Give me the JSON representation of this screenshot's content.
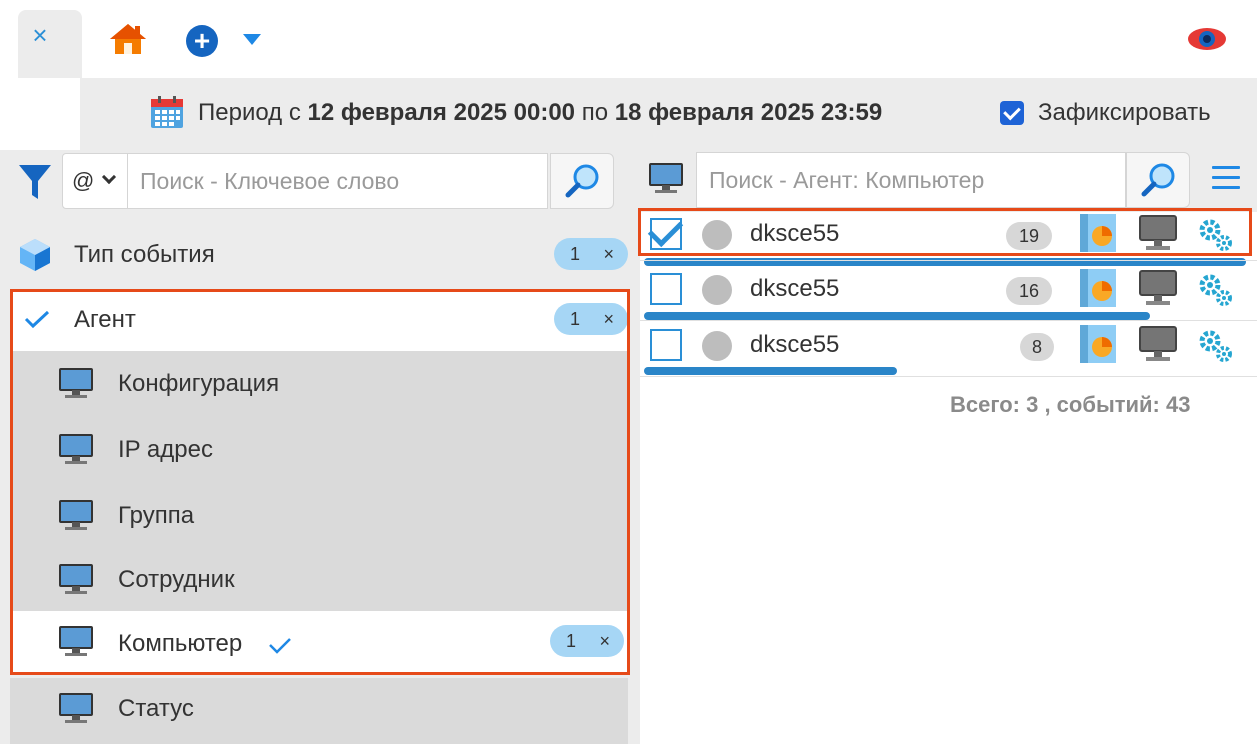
{
  "tabs": {
    "close_glyph": "×",
    "home_icon": "home-icon",
    "add_icon": "plus-circle-icon",
    "view_icon": "eye-icon"
  },
  "period": {
    "prefix": "Период с ",
    "from": "12 февраля 2025 00:00",
    "middle": " по ",
    "to": "18 февраля 2025 23:59",
    "fix_label": "Зафиксировать",
    "fix_checked": true
  },
  "left": {
    "search_mode": "@",
    "search_placeholder": "Поиск - Ключевое слово",
    "items": [
      {
        "label": "Тип события",
        "badge": "1",
        "badge_x": "×"
      },
      {
        "label": "Агент",
        "badge": "1",
        "badge_x": "×"
      },
      {
        "label": "Конфигурация"
      },
      {
        "label": "IP адрес"
      },
      {
        "label": "Группа"
      },
      {
        "label": "Сотрудник"
      },
      {
        "label": "Компьютер",
        "badge": "1",
        "badge_x": "×"
      },
      {
        "label": "Статус"
      }
    ]
  },
  "right": {
    "search_placeholder": "Поиск - Агент: Компьютер",
    "agents": [
      {
        "name": "dksce55",
        "count": "19",
        "checked": true,
        "share": 1.0
      },
      {
        "name": "dksce55",
        "count": "16",
        "checked": false,
        "share": 0.84
      },
      {
        "name": "dksce55",
        "count": "8",
        "checked": false,
        "share": 0.42
      }
    ],
    "total": "Всего: 3 , событий: 43"
  },
  "colors": {
    "accent": "#1e88e5",
    "highlight": "#e64a19",
    "badge": "#a6d6f5",
    "bar": "#2a85c8"
  }
}
